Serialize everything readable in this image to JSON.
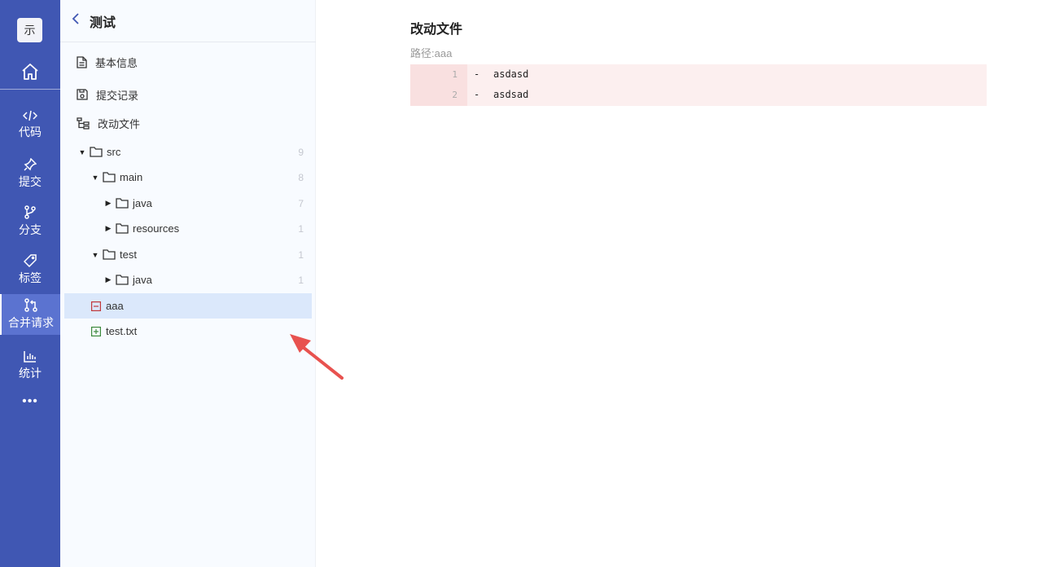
{
  "rail": {
    "logo": "示",
    "items": [
      {
        "label": "代码",
        "icon": "code-icon"
      },
      {
        "label": "提交",
        "icon": "pin-icon"
      },
      {
        "label": "分支",
        "icon": "branch-icon"
      },
      {
        "label": "标签",
        "icon": "tag-icon"
      },
      {
        "label": "合并请求",
        "icon": "merge-request-icon"
      },
      {
        "label": "统计",
        "icon": "bar-chart-icon"
      }
    ],
    "active_index": 4,
    "more": "•••"
  },
  "sidebar": {
    "title": "测试",
    "menu": [
      {
        "label": "基本信息",
        "icon": "document-icon"
      },
      {
        "label": "提交记录",
        "icon": "save-icon"
      },
      {
        "label": "改动文件",
        "icon": "file-tree-icon"
      }
    ],
    "tree": [
      {
        "name": "src",
        "count": "9",
        "type": "folder",
        "expanded": true
      },
      {
        "name": "main",
        "count": "8",
        "type": "folder",
        "expanded": true
      },
      {
        "name": "java",
        "count": "7",
        "type": "folder",
        "expanded": false
      },
      {
        "name": "resources",
        "count": "1",
        "type": "folder",
        "expanded": false
      },
      {
        "name": "test",
        "count": "1",
        "type": "folder",
        "expanded": true
      },
      {
        "name": "java",
        "count": "1",
        "type": "folder",
        "expanded": false
      },
      {
        "name": "aaa",
        "count": "",
        "type": "file-deleted",
        "selected": true
      },
      {
        "name": "test.txt",
        "count": "",
        "type": "file-added"
      }
    ]
  },
  "main": {
    "title": "改动文件",
    "path": "路径:aaa",
    "diff": [
      {
        "num": "1",
        "sign": "-",
        "code": "asdasd"
      },
      {
        "num": "2",
        "sign": "-",
        "code": "asdsad"
      }
    ]
  },
  "colors": {
    "rail": "#4057b3",
    "selected_row": "#dbe8fb",
    "diff_removed": "#fcefef",
    "arrow": "#e8524f"
  }
}
